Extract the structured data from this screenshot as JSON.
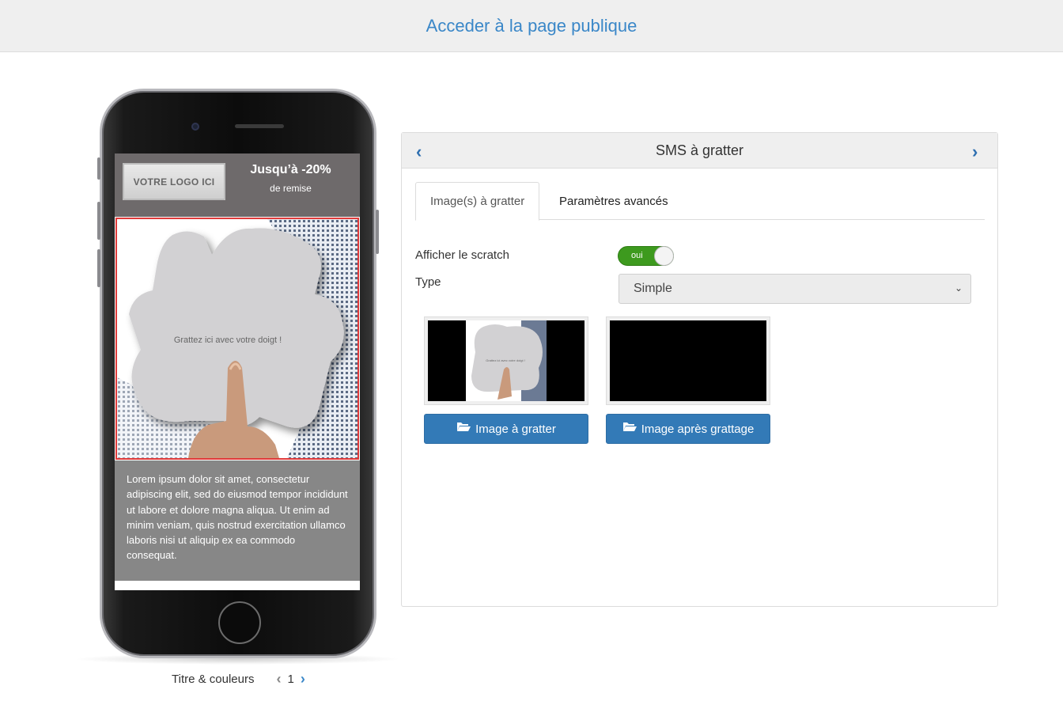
{
  "topbar": {
    "link_label": "Acceder à la page publique"
  },
  "phone": {
    "logo_text": "VOTRE LOGO ICI",
    "promo_title": "Jusqu’à -20%",
    "promo_sub": "de remise",
    "scratch_hint": "Grattez ici avec votre doigt !",
    "body_text": "Lorem ipsum dolor sit amet, consectetur adipiscing elit, sed do eiusmod tempor incididunt ut labore et dolore magna aliqua. Ut enim ad minim veniam, quis nostrud exercitation ullamco laboris nisi ut aliquip ex ea commodo consequat."
  },
  "pager": {
    "title": "Titre & couleurs",
    "page": "1"
  },
  "panel": {
    "title": "SMS à gratter",
    "tabs": [
      {
        "label": "Image(s) à gratter",
        "active": true
      },
      {
        "label": "Paramètres avancés",
        "active": false
      }
    ],
    "show_scratch_label": "Afficher le scratch",
    "toggle_text": "oui",
    "type_label": "Type",
    "type_value": "Simple",
    "mini_hint": "Grattez ici avec votre doigt !",
    "buttons": {
      "scratch_image": "Image à gratter",
      "after_image": "Image après grattage"
    }
  },
  "colors": {
    "accent": "#337ab7",
    "link": "#3a87c8",
    "toggle_on": "#3d9a1e",
    "scratch_border": "#e03a3a"
  }
}
